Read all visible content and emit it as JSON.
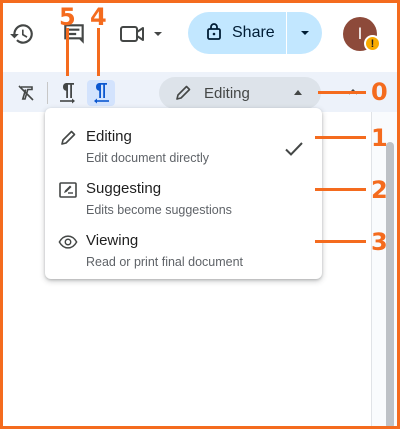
{
  "topbar": {
    "share_label": "Share",
    "avatar_initial": "I",
    "avatar_badge": "!"
  },
  "toolbar": {
    "mode_label": "Editing"
  },
  "menu": {
    "items": [
      {
        "title": "Editing",
        "description": "Edit document directly",
        "icon": "pencil-icon",
        "selected": true
      },
      {
        "title": "Suggesting",
        "description": "Edits become suggestions",
        "icon": "suggest-edit-icon",
        "selected": false
      },
      {
        "title": "Viewing",
        "description": "Read or print final document",
        "icon": "eye-icon",
        "selected": false
      }
    ]
  },
  "annotations": [
    "0",
    "1",
    "2",
    "3",
    "4",
    "5"
  ],
  "colors": {
    "accent": "#f46b1e",
    "share_bg": "#c2e7ff",
    "toolbar_bg": "#edf2fa",
    "active_tool_bg": "#d3e3fd",
    "avatar_bg": "#8d4a3a",
    "badge": "#f9ab00"
  }
}
